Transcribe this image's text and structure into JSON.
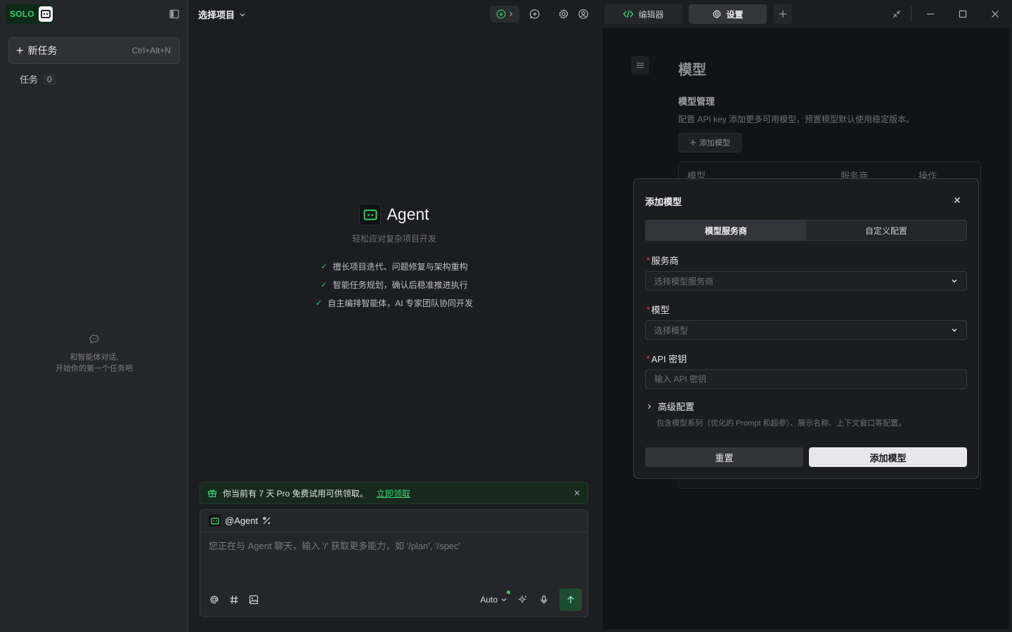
{
  "sidebar": {
    "logo_text": "SOLO",
    "new_task_label": "新任务",
    "new_task_shortcut": "Ctrl+Alt+N",
    "tasks_label": "任务",
    "tasks_count": "0",
    "empty_line1": "和智能体对话,",
    "empty_line2": "开始你的第一个任务吧"
  },
  "main": {
    "project_select": "选择项目",
    "agent_name": "Agent",
    "agent_subtitle": "轻松应对复杂项目开发",
    "features": [
      "擅长项目迭代、问题修复与架构重构",
      "智能任务规划，确认后稳准推进执行",
      "自主编排智能体，AI 专家团队协同开发"
    ],
    "promo_text": "你当前有 7 天 Pro 免费试用可供领取。",
    "promo_link": "立即领取",
    "composer_agent": "@Agent",
    "composer_placeholder": "您正在与 Agent 聊天，输入 '/' 获取更多能力，如 '/plan', '/spec'",
    "mode_label": "Auto"
  },
  "tabs": {
    "editor": "编辑器",
    "settings": "设置"
  },
  "settings": {
    "title": "模型",
    "section": "模型管理",
    "description": "配置 API key 添加更多可用模型，预置模型默认使用稳定版本。",
    "add_model_button": "添加模型",
    "table_headers": [
      "模型",
      "服务商",
      "操作"
    ]
  },
  "modal": {
    "title": "添加模型",
    "tabs": [
      "模型服务商",
      "自定义配置"
    ],
    "provider_label": "服务商",
    "provider_placeholder": "选择模型服务商",
    "model_label": "模型",
    "model_placeholder": "选择模型",
    "apikey_label": "API 密钥",
    "apikey_placeholder": "输入 API 密钥",
    "advanced_label": "高级配置",
    "advanced_desc": "包含模型系列（优化的 Prompt 和超参）、展示名称、上下文窗口等配置。",
    "reset_button": "重置",
    "submit_button": "添加模型",
    "required_mark": "*"
  },
  "colors": {
    "accent_green": "#34c46a",
    "danger": "#e5484d"
  }
}
